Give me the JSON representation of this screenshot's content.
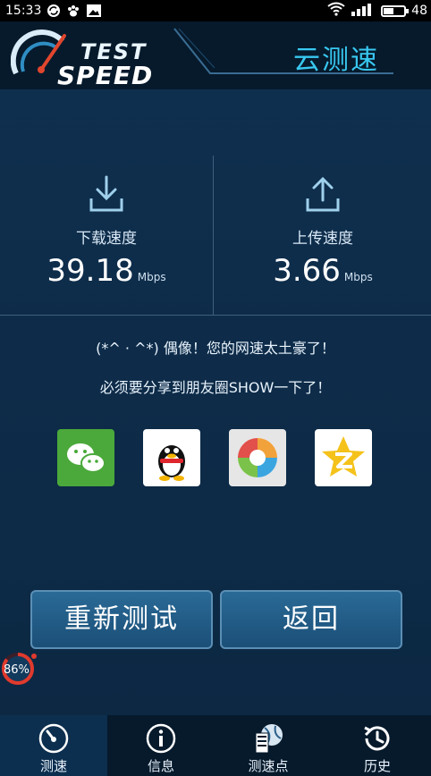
{
  "status_bar": {
    "time": "15:33",
    "battery": "48",
    "battery_level": 0.48
  },
  "header": {
    "logo_top": "TEST",
    "logo_bottom": "SPEED",
    "title": "云测速"
  },
  "download": {
    "label": "下载速度",
    "value": "39.18",
    "unit": "Mbps"
  },
  "upload": {
    "label": "上传速度",
    "value": "3.66",
    "unit": "Mbps"
  },
  "messages": {
    "line1": "(*^ · ^*) 偶像！您的网速太土豪了！",
    "line2": "必须要分享到朋友圈SHOW一下了！"
  },
  "share": [
    {
      "name": "wechat-icon"
    },
    {
      "name": "qq-icon"
    },
    {
      "name": "moments-icon"
    },
    {
      "name": "qzone-icon"
    }
  ],
  "buttons": {
    "retest": "重新测试",
    "back": "返回"
  },
  "progress": {
    "text": "86%",
    "level": 0.86
  },
  "nav": [
    {
      "label": "测速",
      "icon": "speedometer-icon",
      "active": true
    },
    {
      "label": "信息",
      "icon": "info-icon",
      "active": false
    },
    {
      "label": "测速点",
      "icon": "server-globe-icon",
      "active": false
    },
    {
      "label": "历史",
      "icon": "history-icon",
      "active": false
    }
  ],
  "colors": {
    "accent": "#38c8f0",
    "panel": "#0f2f4e",
    "button": "#2a6a96"
  }
}
